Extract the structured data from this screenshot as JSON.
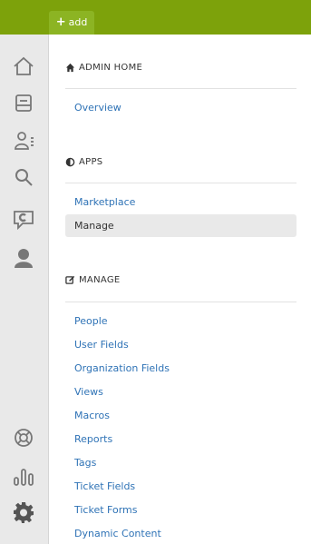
{
  "topbar": {
    "add_label": "add"
  },
  "sidebar": {
    "items": [
      {
        "name": "home-icon"
      },
      {
        "name": "views-icon"
      },
      {
        "name": "customers-icon"
      },
      {
        "name": "search-icon"
      },
      {
        "name": "chat-icon"
      },
      {
        "name": "agent-icon"
      },
      {
        "name": "help-center-icon"
      },
      {
        "name": "reporting-icon"
      },
      {
        "name": "admin-settings-icon"
      }
    ]
  },
  "admin_home": {
    "title": "ADMIN HOME",
    "links": [
      "Overview"
    ]
  },
  "apps": {
    "title": "APPS",
    "links": [
      "Marketplace",
      "Manage"
    ],
    "active": "Manage"
  },
  "manage": {
    "title": "MANAGE",
    "links": [
      "People",
      "User Fields",
      "Organization Fields",
      "Views",
      "Macros",
      "Reports",
      "Tags",
      "Ticket Fields",
      "Ticket Forms",
      "Dynamic Content"
    ]
  },
  "colors": {
    "topbar": "#7da20b",
    "link": "#2f73b6",
    "sidebar": "#e9e9e9",
    "icon": "#777777"
  }
}
